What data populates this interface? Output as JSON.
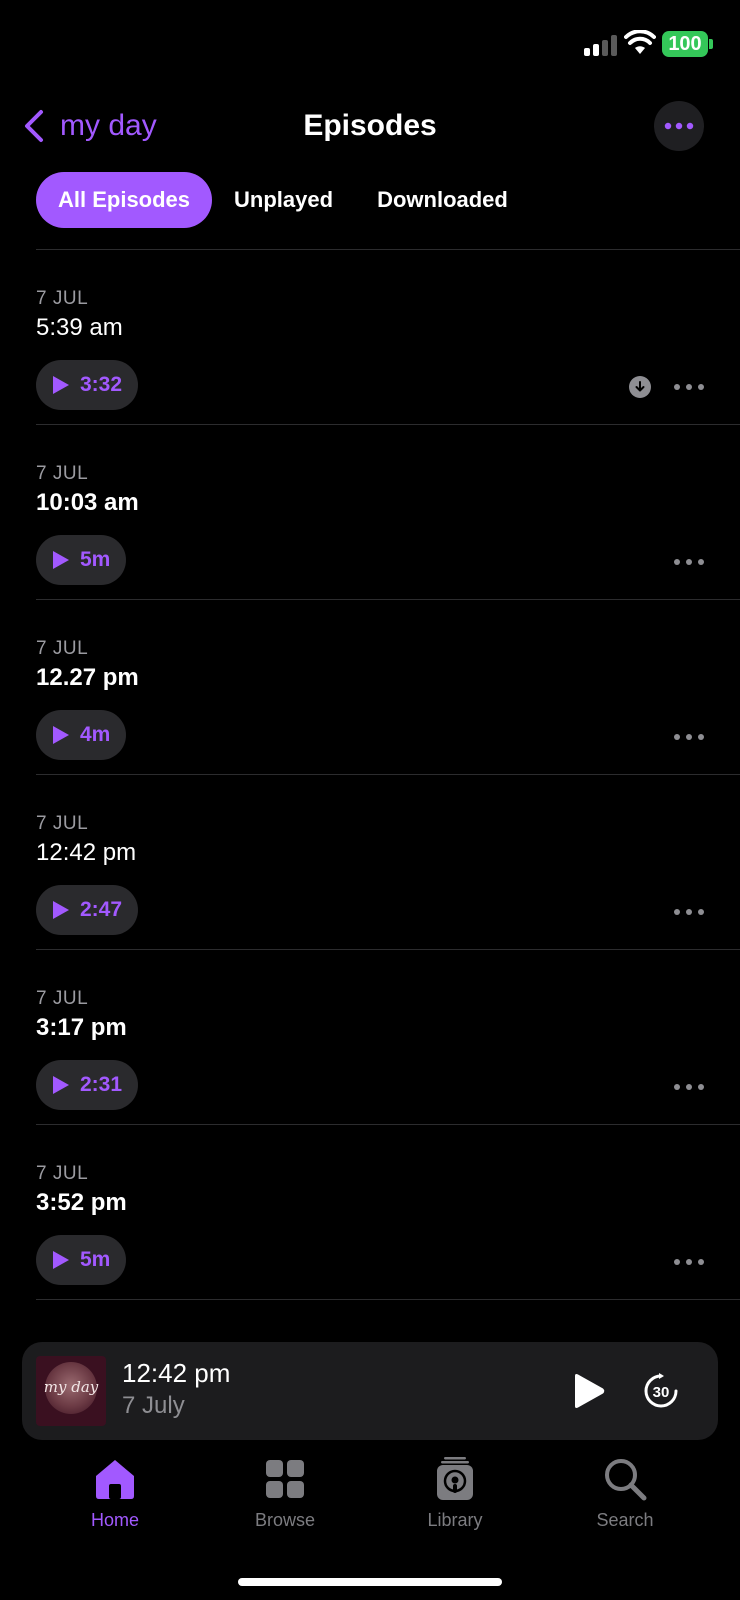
{
  "status_bar": {
    "battery": "100"
  },
  "header": {
    "back_label": "my day",
    "title": "Episodes"
  },
  "tabs": [
    {
      "label": "All Episodes",
      "active": true
    },
    {
      "label": "Unplayed",
      "active": false
    },
    {
      "label": "Downloaded",
      "active": false
    }
  ],
  "episodes": [
    {
      "date": "7 JUL",
      "title": "5:39 am",
      "duration": "3:32",
      "bold": false,
      "downloadable": true
    },
    {
      "date": "7 JUL",
      "title": "10:03 am",
      "duration": "5m",
      "bold": true,
      "downloadable": false
    },
    {
      "date": "7 JUL",
      "title": "12.27 pm",
      "duration": "4m",
      "bold": true,
      "downloadable": false
    },
    {
      "date": "7 JUL",
      "title": "12:42 pm",
      "duration": "2:47",
      "bold": false,
      "downloadable": false
    },
    {
      "date": "7 JUL",
      "title": "3:17 pm",
      "duration": "2:31",
      "bold": true,
      "downloadable": false
    },
    {
      "date": "7 JUL",
      "title": "3:52 pm",
      "duration": "5m",
      "bold": true,
      "downloadable": false
    }
  ],
  "mini_player": {
    "title": "12:42 pm",
    "subtitle": "7 July",
    "artwork_text": "my day",
    "skip_seconds": "30"
  },
  "tab_bar": [
    {
      "label": "Home",
      "icon": "home-icon",
      "active": true
    },
    {
      "label": "Browse",
      "icon": "grid-icon",
      "active": false
    },
    {
      "label": "Library",
      "icon": "library-icon",
      "active": false
    },
    {
      "label": "Search",
      "icon": "search-icon",
      "active": false
    }
  ],
  "colors": {
    "accent": "#a259ff",
    "battery": "#34c759",
    "background": "#000000"
  }
}
